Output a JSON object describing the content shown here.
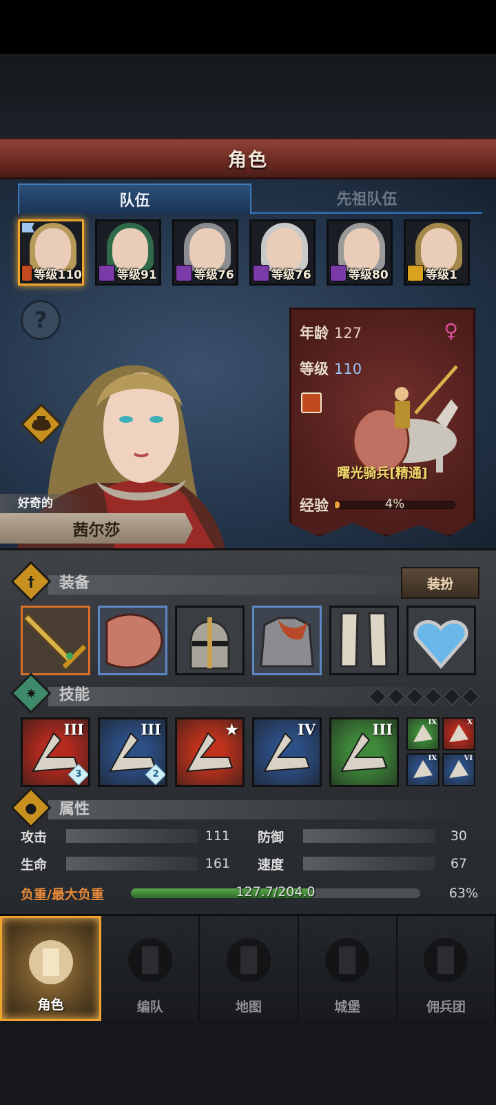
{
  "screen_title": "角色",
  "tabs": [
    {
      "label": "队伍",
      "active": true
    },
    {
      "label": "先祖队伍",
      "active": false
    }
  ],
  "roster": [
    {
      "level_label": "等级110",
      "class_color": "#c04a1e",
      "hair": "#b59a5a",
      "selected": true
    },
    {
      "level_label": "等级91",
      "class_color": "#7a3aa8",
      "hair": "#2f6a4a",
      "selected": false
    },
    {
      "level_label": "等级76",
      "class_color": "#7a3aa8",
      "hair": "#8a8c90",
      "selected": false
    },
    {
      "level_label": "等级76",
      "class_color": "#7a3aa8",
      "hair": "#c9c9c9",
      "selected": false
    },
    {
      "level_label": "等级80",
      "class_color": "#7a3aa8",
      "hair": "#9a9a9a",
      "selected": false
    },
    {
      "level_label": "等级1",
      "class_color": "#d8a21e",
      "hair": "#a4884a",
      "selected": false
    }
  ],
  "character": {
    "trait": "好奇的",
    "name": "茜尔莎",
    "age_label": "年龄",
    "age": "127",
    "level_label": "等级",
    "level": "110",
    "gender_symbol": "♀",
    "class_name": "曙光骑兵[精通]",
    "exp_label": "经验",
    "exp_percent_text": "4%",
    "exp_fraction": 0.04
  },
  "equipment": {
    "title": "装备",
    "dress_button": "装扮",
    "items": [
      {
        "icon": "golden-sword-icon",
        "rarity": "orange"
      },
      {
        "icon": "round-shield-icon",
        "rarity": "blue"
      },
      {
        "icon": "helmet-icon",
        "rarity": "none"
      },
      {
        "icon": "chainmail-armor-icon",
        "rarity": "blue"
      },
      {
        "icon": "greaves-icon",
        "rarity": "none"
      },
      {
        "icon": "heart-amulet-icon",
        "rarity": "none"
      }
    ]
  },
  "skills": {
    "title": "技能",
    "gem_count": 6,
    "items": [
      {
        "rank": "III",
        "badge": "3",
        "color": "#b52a1e"
      },
      {
        "rank": "III",
        "badge": "2",
        "color": "#2c4f86"
      },
      {
        "rank": "★",
        "badge": "",
        "color": "#c0321c"
      },
      {
        "rank": "IV",
        "badge": "",
        "color": "#2c4f86"
      },
      {
        "rank": "III",
        "badge": "",
        "color": "#3f8a3a"
      }
    ],
    "minis": [
      {
        "rank": "IX",
        "color": "#3f8a3a"
      },
      {
        "rank": "X",
        "color": "#b52a1e"
      },
      {
        "rank": "IX",
        "color": "#2c4f86"
      },
      {
        "rank": "VI",
        "color": "#2c4f86"
      }
    ]
  },
  "attributes": {
    "title": "属性",
    "attack_label": "攻击",
    "attack": "111",
    "defense_label": "防御",
    "defense": "30",
    "hp_label": "生命",
    "hp": "161",
    "speed_label": "速度",
    "speed": "67",
    "load_label": "负重/最大负重",
    "load_text": "127.7/204.0",
    "load_percent_text": "63%",
    "load_fraction": 0.63
  },
  "nav": [
    {
      "label": "角色",
      "icon": "knight-icon",
      "active": true
    },
    {
      "label": "编队",
      "icon": "formation-icon",
      "active": false
    },
    {
      "label": "地图",
      "icon": "compass-map-icon",
      "active": false
    },
    {
      "label": "城堡",
      "icon": "castle-icon",
      "active": false
    },
    {
      "label": "佣兵团",
      "icon": "mercenary-banner-icon",
      "active": false
    }
  ],
  "colors": {
    "accent_orange": "#f0a62a",
    "tab_blue": "#3f78b8",
    "load_green": "#58a84a",
    "gender_pink": "#e24f9c"
  }
}
